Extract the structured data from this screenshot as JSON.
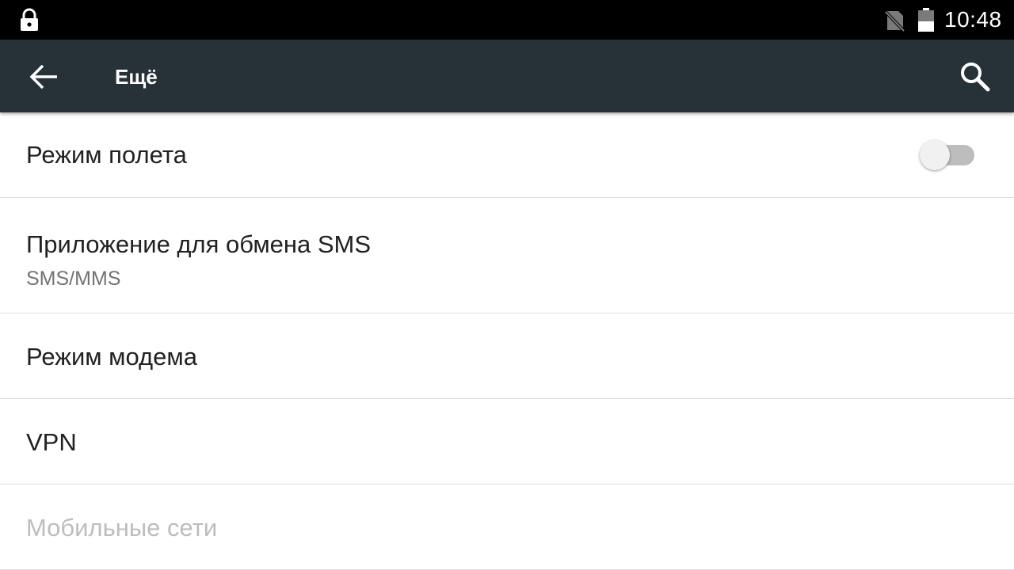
{
  "status_bar": {
    "time": "10:48",
    "icons": [
      "lock-icon",
      "no-sim-icon",
      "battery-icon"
    ]
  },
  "app_bar": {
    "title": "Ещё",
    "back_icon": "arrow-back-icon",
    "search_icon": "search-icon",
    "background": "#263238"
  },
  "settings": [
    {
      "label": "Режим полета",
      "toggle": false
    },
    {
      "label": "Приложение для обмена SMS",
      "summary": "SMS/MMS"
    },
    {
      "label": "Режим модема"
    },
    {
      "label": "VPN"
    },
    {
      "label": "Мобильные сети",
      "enabled": false
    }
  ]
}
